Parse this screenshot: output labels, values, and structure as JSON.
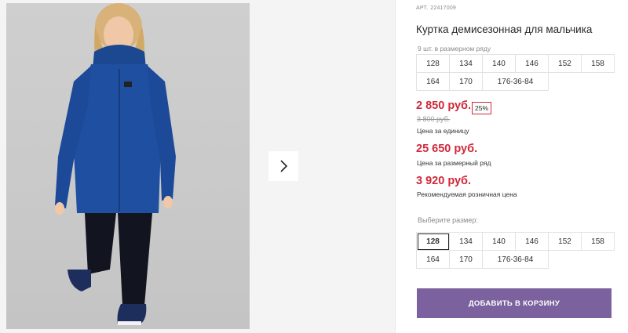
{
  "product": {
    "sku_label": "АРТ.",
    "sku": "22417009",
    "title": "Куртка демисезонная для мальчика",
    "pack_note": "9 шт. в размерном ряду",
    "pack_sizes": [
      "128",
      "134",
      "140",
      "146",
      "152",
      "158",
      "164",
      "170",
      "176-36-84"
    ]
  },
  "pricing": {
    "unit_price": "2 850 руб.",
    "discount": "25%",
    "old_price": "3 800 руб.",
    "unit_price_label": "Цена за единицу",
    "pack_price": "25 650 руб.",
    "pack_price_label": "Цена за размерный ряд",
    "retail_price": "3 920 руб.",
    "retail_price_label": "Рекомендуемая розничная цена"
  },
  "size_selector": {
    "label": "Выберите размер:",
    "options": [
      "128",
      "134",
      "140",
      "146",
      "152",
      "158",
      "164",
      "170",
      "176-36-84"
    ],
    "selected": "128"
  },
  "actions": {
    "add_to_cart": "ДОБАВИТЬ В КОРЗИНУ"
  },
  "gallery": {
    "next_icon": "chevron-right-icon",
    "image_subject": "boy in blue parka"
  },
  "colors": {
    "price_red": "#d0283a",
    "button_purple": "#7b619e",
    "jacket_blue": "#1f4fa0"
  }
}
